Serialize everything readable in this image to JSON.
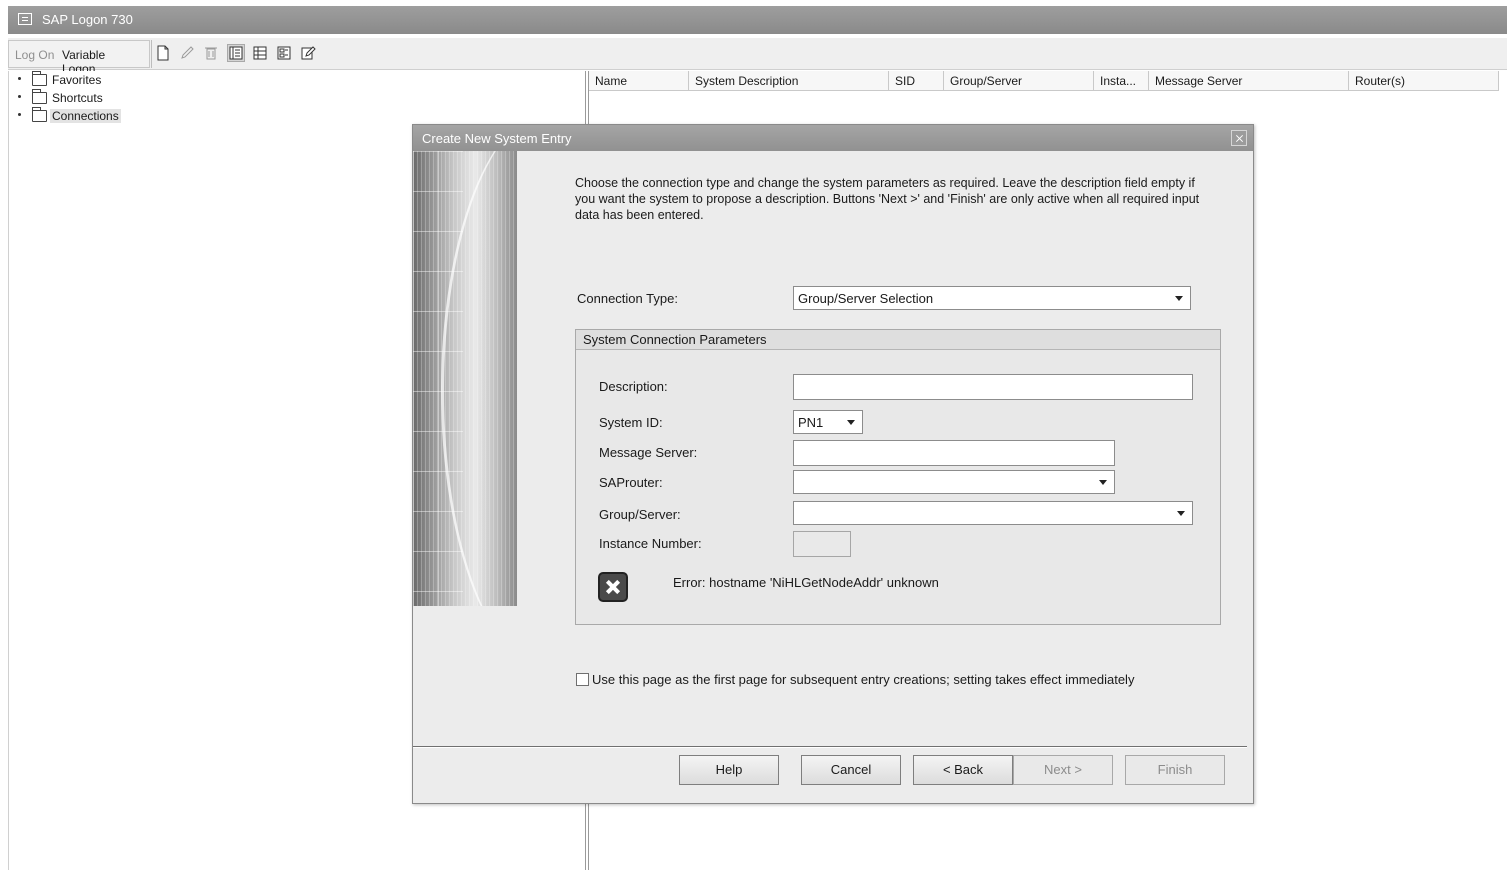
{
  "window": {
    "title": "SAP Logon 730"
  },
  "toolbar": {
    "logon_label": "Log On",
    "variable_logon_label": "Variable Logon...",
    "icons": [
      "new-entry-icon",
      "edit-icon",
      "delete-icon",
      "tree-view-icon",
      "list-view-icon",
      "explorer-view-icon",
      "edit-notes-icon"
    ]
  },
  "tree": {
    "items": [
      {
        "label": "Favorites",
        "selected": false
      },
      {
        "label": "Shortcuts",
        "selected": false
      },
      {
        "label": "Connections",
        "selected": true
      }
    ]
  },
  "list": {
    "columns": [
      "Name",
      "System Description",
      "SID",
      "Group/Server",
      "Insta...",
      "Message Server",
      "Router(s)"
    ]
  },
  "dialog": {
    "title": "Create New System Entry",
    "intro": "Choose the connection type and change the system parameters as required. Leave the description field empty if you want the system to propose a description. Buttons 'Next >' and 'Finish' are only active when all required input data has been entered.",
    "connection_type": {
      "label": "Connection Type:",
      "value": "Group/Server Selection"
    },
    "params": {
      "header": "System Connection Parameters",
      "description": {
        "label": "Description:",
        "value": ""
      },
      "system_id": {
        "label": "System ID:",
        "value": "PN1"
      },
      "message_server": {
        "label": "Message Server:",
        "value": ""
      },
      "saprouter": {
        "label": "SAProuter:",
        "value": ""
      },
      "group_server": {
        "label": "Group/Server:",
        "value": ""
      },
      "instance_number": {
        "label": "Instance Number:",
        "value": ""
      },
      "error": "Error: hostname 'NiHLGetNodeAddr' unknown"
    },
    "checkbox": {
      "label": "Use this page as the first page for subsequent entry creations; setting takes effect immediately",
      "checked": false
    },
    "buttons": {
      "help": "Help",
      "cancel": "Cancel",
      "back": "< Back",
      "next": "Next >",
      "finish": "Finish"
    }
  }
}
